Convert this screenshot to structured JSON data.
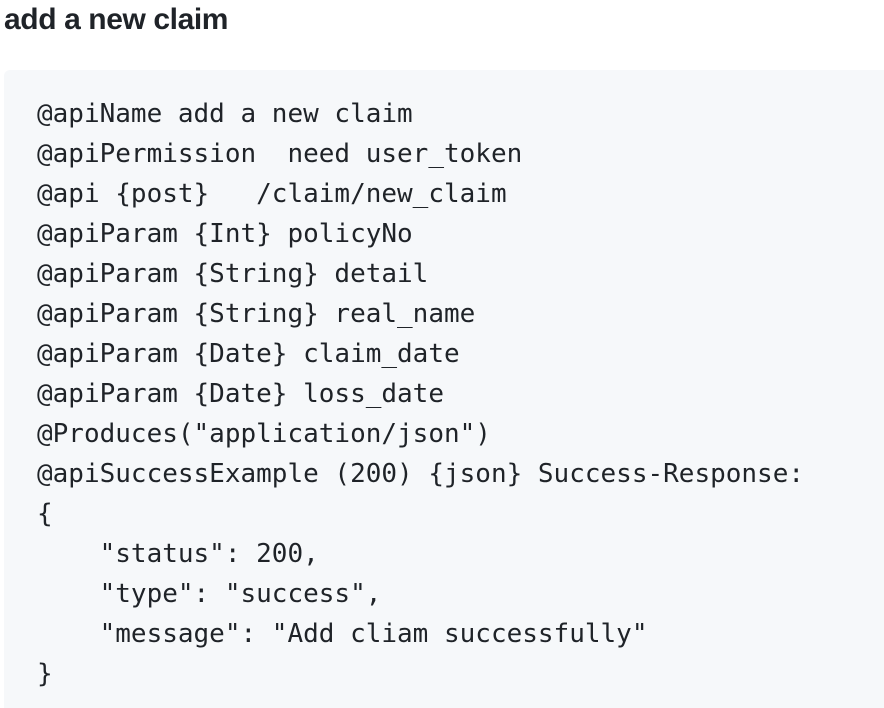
{
  "heading": "add a new claim",
  "code_lines": [
    "@apiName add a new claim",
    "@apiPermission  need user_token",
    "@api {post}   /claim/new_claim",
    "@apiParam {Int} policyNo",
    "@apiParam {String} detail",
    "@apiParam {String} real_name",
    "@apiParam {Date} claim_date",
    "@apiParam {Date} loss_date",
    "@Produces(\"application/json\")",
    "@apiSuccessExample (200) {json} Success-Response:",
    "{",
    "    \"status\": 200,",
    "    \"type\": \"success\",",
    "    \"message\": \"Add cliam successfully\"",
    "}"
  ]
}
